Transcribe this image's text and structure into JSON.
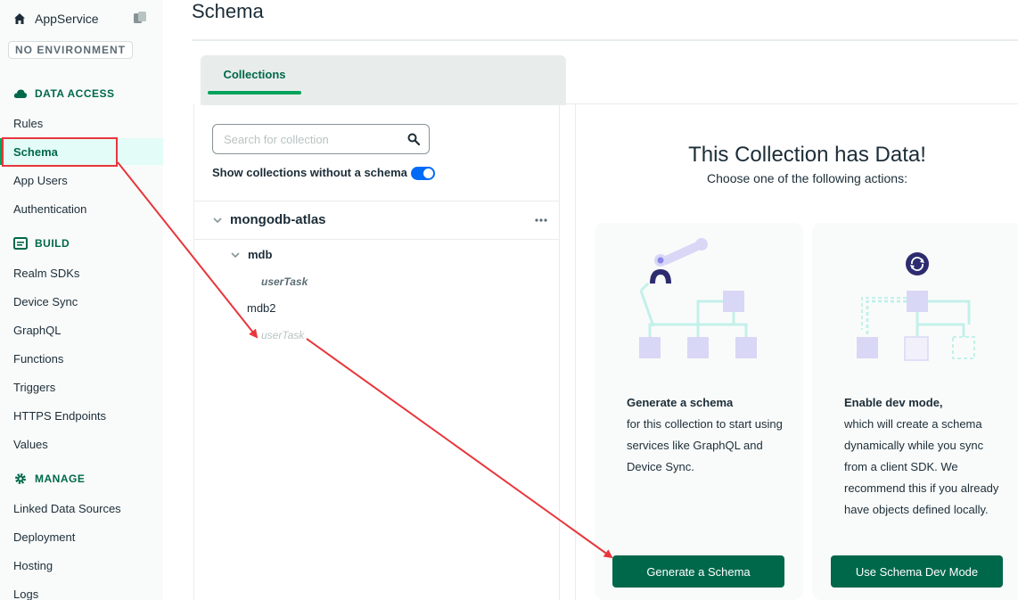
{
  "sidebar": {
    "app_name": "AppService",
    "environment": "NO ENVIRONMENT",
    "sections": {
      "data_access": "DATA ACCESS",
      "build": "BUILD",
      "manage": "MANAGE"
    },
    "items": [
      {
        "label": "Rules"
      },
      {
        "label": "Schema"
      },
      {
        "label": "App Users"
      },
      {
        "label": "Authentication"
      },
      {
        "label": "Realm SDKs"
      },
      {
        "label": "Device Sync"
      },
      {
        "label": "GraphQL"
      },
      {
        "label": "Functions"
      },
      {
        "label": "Triggers"
      },
      {
        "label": "HTTPS Endpoints"
      },
      {
        "label": "Values"
      },
      {
        "label": "Linked Data Sources"
      },
      {
        "label": "Deployment"
      },
      {
        "label": "Hosting"
      },
      {
        "label": "Logs"
      }
    ]
  },
  "header": {
    "title": "Schema"
  },
  "tabs": [
    {
      "label": "Collections"
    }
  ],
  "collections": {
    "search_placeholder": "Search for collection",
    "show_toggle_label": "Show collections without a schema",
    "show_toggle_on": true,
    "cluster": "mongodb-atlas",
    "databases": [
      {
        "name": "mdb",
        "collections": [
          "userTask"
        ]
      },
      {
        "name": "mdb2",
        "collections": [
          "userTask"
        ]
      }
    ]
  },
  "main": {
    "title": "This Collection has Data!",
    "subtitle": "Choose one of the following actions:",
    "cards": [
      {
        "heading": "Generate a schema",
        "body": "for this collection to start using services like GraphQL and Device Sync.",
        "button": "Generate a Schema"
      },
      {
        "heading": "Enable dev mode,",
        "body": "which will create a schema dynamically while you sync from a client SDK. We recommend this if you already have objects defined locally.",
        "button": "Use Schema Dev Mode"
      }
    ]
  },
  "colors": {
    "brand_green": "#00684a",
    "accent_green": "#00a35c",
    "annotation_red": "#e8363b",
    "toggle_blue": "#016bf8",
    "illustration_purple": "#d9d7f6",
    "illustration_teal": "#c3f0ea"
  }
}
